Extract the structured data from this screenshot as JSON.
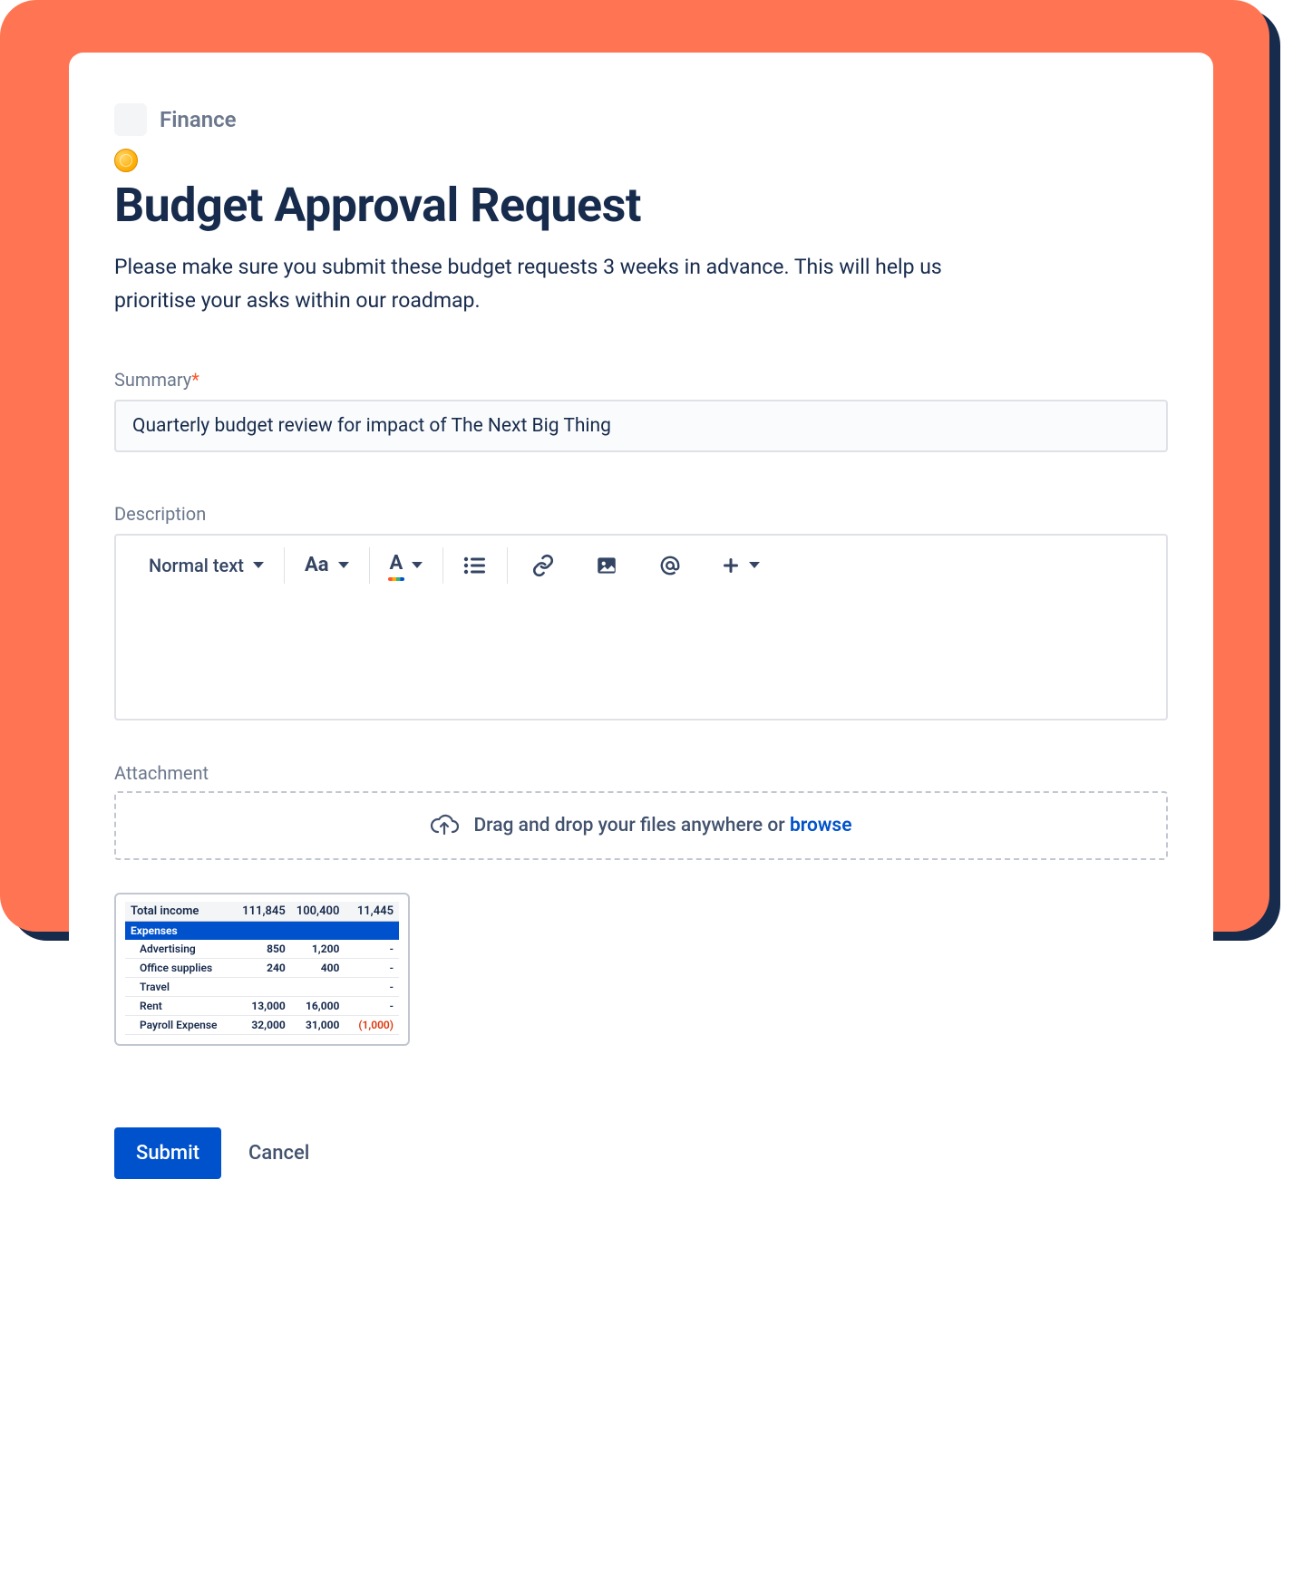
{
  "breadcrumb": {
    "category": "Finance"
  },
  "title": "Budget Approval Request",
  "intro": "Please make sure you submit these budget requests 3 weeks in advance. This will help us prioritise your asks within our roadmap.",
  "summary": {
    "label": "Summary",
    "value": "Quarterly budget review for impact of The Next Big Thing"
  },
  "description": {
    "label": "Description",
    "toolbar": {
      "text_style_label": "Normal text",
      "case_label": "Aa",
      "color_label": "A"
    }
  },
  "attachment": {
    "label": "Attachment",
    "drop_text": "Drag and drop your files anywhere or ",
    "browse": "browse"
  },
  "thumbnail": {
    "total_income_label": "Total income",
    "total_income": [
      "111,845",
      "100,400",
      "11,445"
    ],
    "section": "Expenses",
    "rows": [
      {
        "label": "Advertising",
        "a": "850",
        "b": "1,200",
        "c": "-"
      },
      {
        "label": "Office supplies",
        "a": "240",
        "b": "400",
        "c": "-"
      },
      {
        "label": "Travel",
        "a": "",
        "b": "",
        "c": "-"
      },
      {
        "label": "Rent",
        "a": "13,000",
        "b": "16,000",
        "c": "-"
      },
      {
        "label": "Payroll Expense",
        "a": "32,000",
        "b": "31,000",
        "c": "(1,000)",
        "neg": true
      }
    ]
  },
  "actions": {
    "submit": "Submit",
    "cancel": "Cancel"
  }
}
